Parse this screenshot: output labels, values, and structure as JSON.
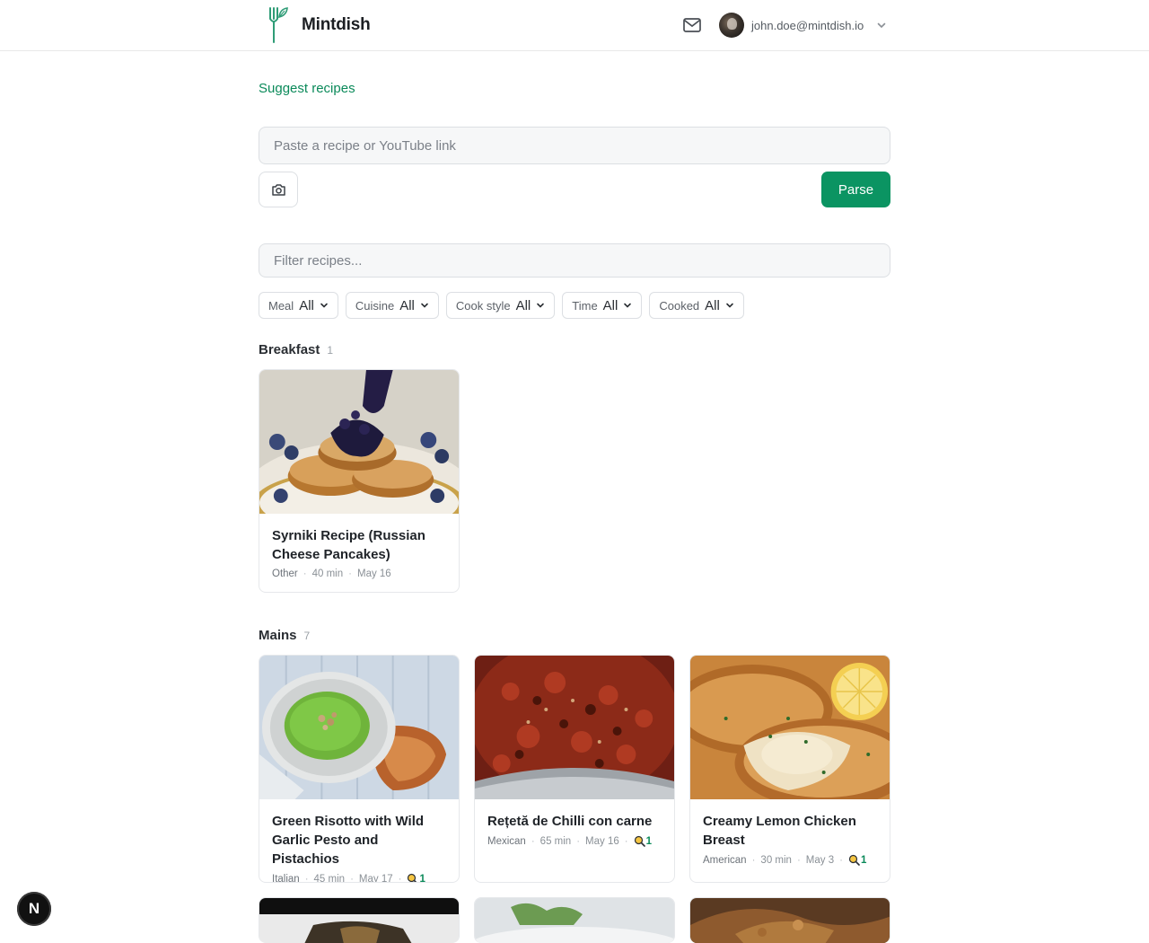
{
  "app": {
    "name": "Mintdish"
  },
  "header": {
    "user_email": "john.doe@mintdish.io"
  },
  "suggest": {
    "label": "Suggest recipes"
  },
  "parser": {
    "placeholder": "Paste a recipe or YouTube link",
    "parse_label": "Parse"
  },
  "filter": {
    "placeholder": "Filter recipes..."
  },
  "chips": [
    {
      "label": "Meal",
      "value": "All"
    },
    {
      "label": "Cuisine",
      "value": "All"
    },
    {
      "label": "Cook style",
      "value": "All"
    },
    {
      "label": "Time",
      "value": "All"
    },
    {
      "label": "Cooked",
      "value": "All"
    }
  ],
  "sections": {
    "breakfast": {
      "title": "Breakfast",
      "count": "1",
      "recipes": [
        {
          "title": "Syrniki Recipe (Russian Cheese Pancakes)",
          "cuisine": "Other",
          "time": "40 min",
          "date": "May 16",
          "cooked": ""
        }
      ]
    },
    "mains": {
      "title": "Mains",
      "count": "7",
      "recipes": [
        {
          "title": "Green Risotto with Wild Garlic Pesto and Pistachios",
          "cuisine": "Italian",
          "time": "45 min",
          "date": "May 17",
          "cooked": "1"
        },
        {
          "title": "Rețetă de Chilli con carne",
          "cuisine": "Mexican",
          "time": "65 min",
          "date": "May 16",
          "cooked": "1"
        },
        {
          "title": "Creamy Lemon Chicken Breast",
          "cuisine": "American",
          "time": "30 min",
          "date": "May 3",
          "cooked": "1"
        }
      ]
    }
  },
  "colors": {
    "accent": "#0b9462",
    "accent_text": "#0b8a5a",
    "border": "#dcdfe3"
  },
  "icons": [
    "fork-leaf-logo-icon",
    "mail-icon",
    "chevron-down-icon",
    "camera-icon",
    "skillet-icon"
  ],
  "dev_badge": {
    "letter": "N"
  }
}
